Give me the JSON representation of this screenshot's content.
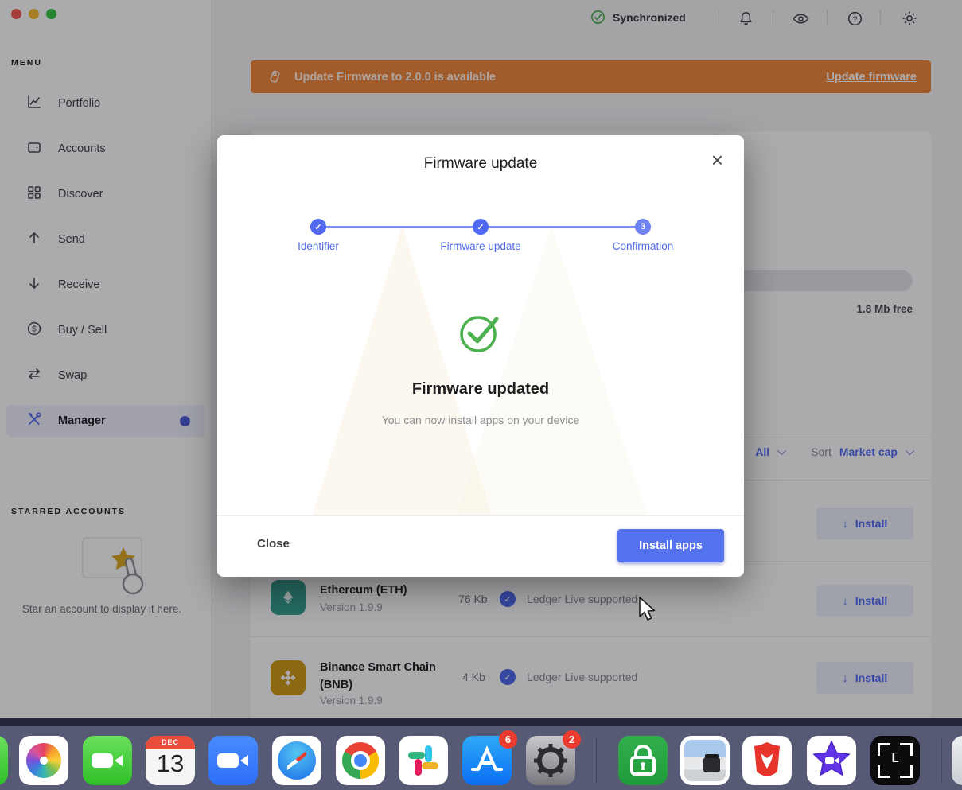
{
  "topbar": {
    "sync": "Synchronized"
  },
  "banner": {
    "message": "Update Firmware to 2.0.0 is available",
    "action": "Update firmware"
  },
  "sidebar": {
    "menu_title": "MENU",
    "items": [
      {
        "label": "Portfolio"
      },
      {
        "label": "Accounts"
      },
      {
        "label": "Discover"
      },
      {
        "label": "Send"
      },
      {
        "label": "Receive"
      },
      {
        "label": "Buy / Sell"
      },
      {
        "label": "Swap"
      },
      {
        "label": "Manager"
      }
    ],
    "starred_title": "STARRED ACCOUNTS",
    "starred_hint": "Star an account to display it here."
  },
  "device": {
    "free_space": "1.8 Mb free"
  },
  "catalog": {
    "filter_all": "All",
    "sort_label": "Sort",
    "sort_value": "Market cap",
    "install_label": "Install",
    "apps": [
      {
        "name": "Ethereum (ETH)",
        "version": "Version 1.9.9",
        "size": "76 Kb",
        "support": "Ledger Live supported"
      },
      {
        "name": "Binance Smart Chain (BNB)",
        "version": "Version 1.9.9",
        "size": "4 Kb",
        "support": "Ledger Live supported"
      }
    ]
  },
  "modal": {
    "title": "Firmware update",
    "steps": [
      {
        "label": "Identifier"
      },
      {
        "label": "Firmware update"
      },
      {
        "label": "Confirmation",
        "number": "3"
      }
    ],
    "result_title": "Firmware updated",
    "result_subtitle": "You can now install apps on your device",
    "close_label": "Close",
    "primary_label": "Install apps"
  },
  "dock": {
    "calendar": {
      "month": "DEC",
      "day": "13"
    },
    "badges": {
      "appstore": "6",
      "settings": "2"
    }
  },
  "colors": {
    "accent": "#5069f0",
    "success": "#4db14f",
    "banner_orange": "#f2863a",
    "badge_red": "#ee3b2f"
  }
}
